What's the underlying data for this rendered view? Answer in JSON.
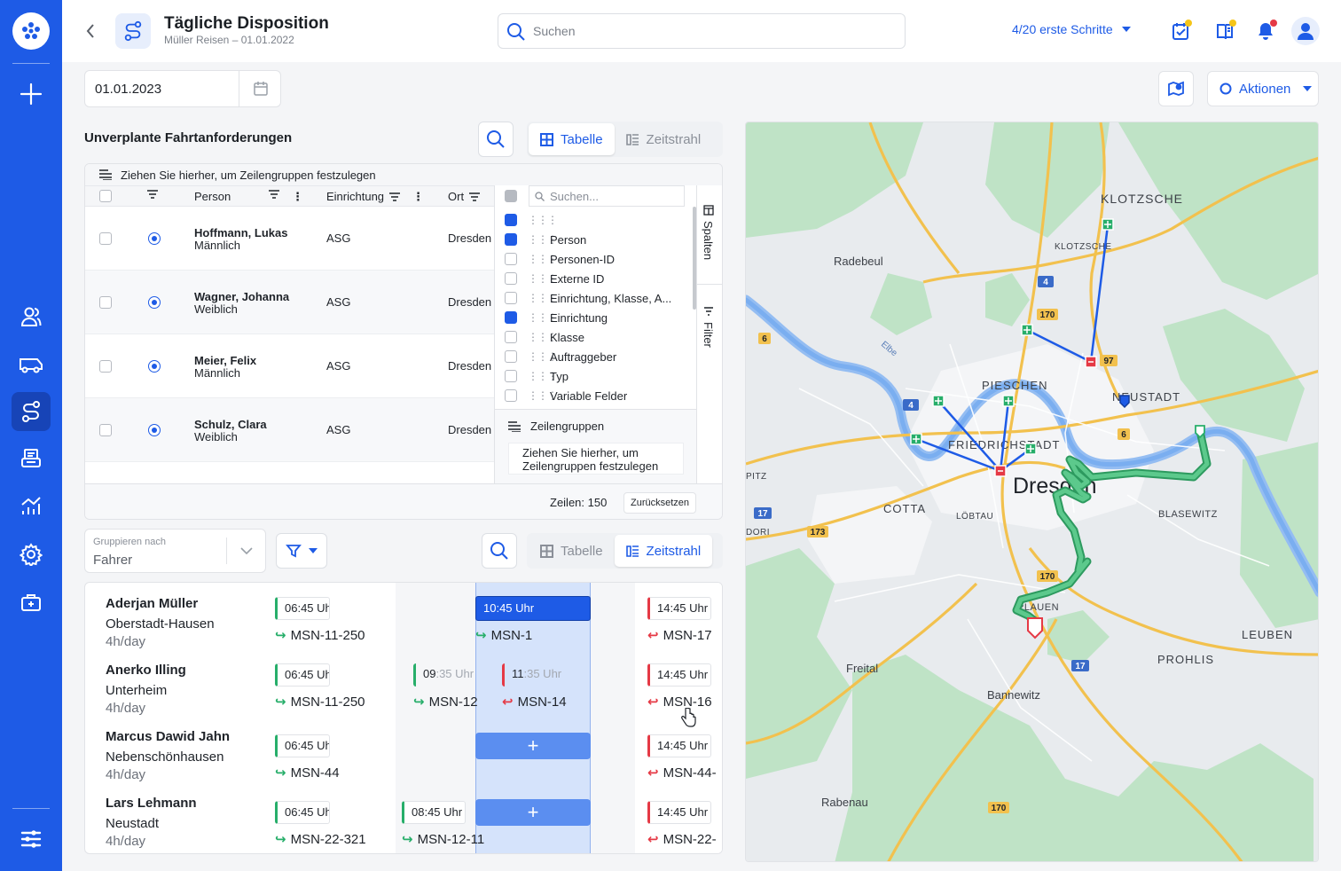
{
  "header": {
    "title": "Tägliche Disposition",
    "subtitle": "Müller Reisen – 01.01.2022",
    "search_placeholder": "Suchen",
    "steps": "4/20 erste Schritte"
  },
  "toolbar": {
    "date": "01.01.2023",
    "actions_label": "Aktionen"
  },
  "top_panel": {
    "title": "Unverplante Fahrtanforderungen",
    "view_table": "Tabelle",
    "view_timeline": "Zeitstrahl",
    "group_hint": "Ziehen Sie hierher, um Zeilengruppen festzulegen",
    "columns": {
      "person": "Person",
      "einrichtung": "Einrichtung",
      "ort": "Ort"
    },
    "rows": [
      {
        "name": "Hoffmann, Lukas",
        "sex": "Männlich",
        "einrichtung": "ASG",
        "ort": "Dresden"
      },
      {
        "name": "Wagner, Johanna",
        "sex": "Weiblich",
        "einrichtung": "ASG",
        "ort": "Dresden"
      },
      {
        "name": "Meier, Felix",
        "sex": "Männlich",
        "einrichtung": "ASG",
        "ort": "Dresden"
      },
      {
        "name": "Schulz, Clara",
        "sex": "Weiblich",
        "einrichtung": "ASG",
        "ort": "Dresden"
      }
    ],
    "column_panel": {
      "search_placeholder": "Suchen...",
      "items": [
        {
          "label": "",
          "checked": true
        },
        {
          "label": "Person",
          "checked": true
        },
        {
          "label": "Personen-ID",
          "checked": false
        },
        {
          "label": "Externe ID",
          "checked": false
        },
        {
          "label": "Einrichtung, Klasse, A...",
          "checked": false
        },
        {
          "label": "Einrichtung",
          "checked": true
        },
        {
          "label": "Klasse",
          "checked": false
        },
        {
          "label": "Auftraggeber",
          "checked": false
        },
        {
          "label": "Typ",
          "checked": false
        },
        {
          "label": "Variable Felder",
          "checked": false
        }
      ],
      "row_groups_title": "Zeilengruppen",
      "row_groups_hint": "Ziehen Sie hierher, um Zeilengruppen festzulegen",
      "tab_columns": "Spalten",
      "tab_filter": "Filter"
    },
    "footer": {
      "rows": "Zeilen: 150",
      "reset": "Zurücksetzen"
    }
  },
  "bottom_panel": {
    "group_label": "Gruppieren nach",
    "group_value": "Fahrer",
    "view_table": "Tabelle",
    "view_timeline": "Zeitstrahl",
    "drivers": [
      {
        "name": "Aderjan Müller",
        "city": "Oberstadt-Hausen",
        "hours": "4h/day"
      },
      {
        "name": "Anerko Illing",
        "city": "Unterheim",
        "hours": "4h/day"
      },
      {
        "name": "Marcus Dawid Jahn",
        "city": "Nebenschönhausen",
        "hours": "4h/day"
      },
      {
        "name": "Lars Lehmann",
        "city": "Neustadt",
        "hours": "4h/day"
      }
    ],
    "trips": {
      "r1": [
        {
          "time": "06:45 Uhr",
          "id": "MSN-11-250"
        },
        {
          "time": "10:45 Uhr",
          "id": "MSN-1"
        },
        {
          "time": "14:45 Uhr",
          "id": "MSN-17"
        }
      ],
      "r2": [
        {
          "time": "06:45 Uhr",
          "id": "MSN-11-250"
        },
        {
          "time_a": "09",
          "time_b": ":35 Uhr",
          "id": "MSN-12"
        },
        {
          "time_a": "11",
          "time_b": ":35 Uhr",
          "id": "MSN-14"
        },
        {
          "time": "14:45 Uhr",
          "id": "MSN-16"
        }
      ],
      "r3": [
        {
          "time": "06:45 Uhr",
          "id": "MSN-44"
        },
        {
          "time": "14:45 Uhr",
          "id": "MSN-44-"
        }
      ],
      "r4": [
        {
          "time": "06:45 Uhr",
          "id": "MSN-22-321"
        },
        {
          "time": "08:45 Uhr",
          "id": "MSN-12-11"
        },
        {
          "time": "14:45 Uhr",
          "id": "MSN-22-"
        }
      ]
    }
  },
  "map": {
    "labels": {
      "klotzsche": "KLOTZSCHE",
      "klotzsche_small": "KLOTZSCHE",
      "radebeul": "Radebeul",
      "pieschen": "PIESCHEN",
      "neustadt": "NEUSTADT",
      "friedrichstadt": "FRIEDRICHSTADT",
      "dresden": "Dresden",
      "cotta": "COTTA",
      "loebtau": "LÖBTAU",
      "blasewitz": "BLASEWITZ",
      "plauen": "PLAUEN",
      "leuben": "LEUBEN",
      "prohlis": "PROHLIS",
      "freital": "Freital",
      "bannewitz": "Bannewitz",
      "rabenau": "Rabenau",
      "elbe": "Elbe",
      "pitz": "PITZ",
      "dori": "DORI"
    },
    "road_numbers": {
      "r4a": "4",
      "r4b": "4",
      "r170a": "170",
      "r170b": "170",
      "r170c": "170",
      "r6a": "6",
      "r6b": "6",
      "r97": "97",
      "r17a": "17",
      "r17b": "17",
      "r173": "173"
    }
  }
}
